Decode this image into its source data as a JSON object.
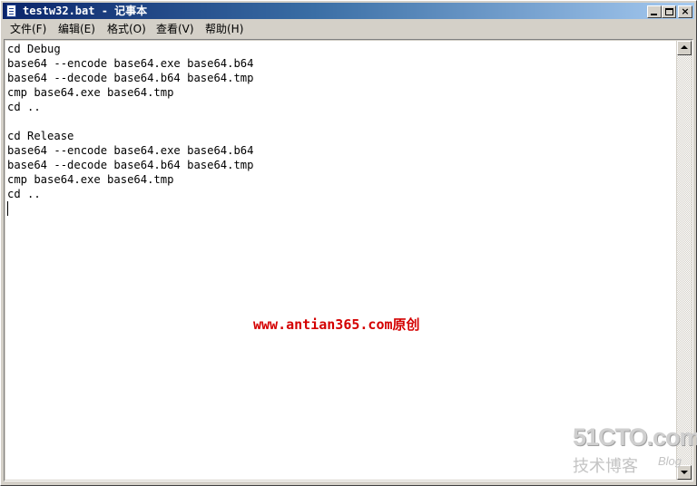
{
  "window": {
    "title": "testw32.bat - 记事本",
    "minimize_glyph": "",
    "maximize_glyph": "",
    "close_glyph": "×"
  },
  "menubar": {
    "items": [
      {
        "label": "文件(F)"
      },
      {
        "label": "编辑(E)"
      },
      {
        "label": "格式(O)"
      },
      {
        "label": "查看(V)"
      },
      {
        "label": "帮助(H)"
      }
    ]
  },
  "editor": {
    "content": "cd Debug\nbase64 --encode base64.exe base64.b64\nbase64 --decode base64.b64 base64.tmp\ncmp base64.exe base64.tmp\ncd ..\n\ncd Release\nbase64 --encode base64.exe base64.b64\nbase64 --decode base64.b64 base64.tmp\ncmp base64.exe base64.tmp\ncd ..\n"
  },
  "overlay": {
    "watermark": "www.antian365.com原创"
  },
  "logo": {
    "main": "51CTO.com",
    "sub": "技术博客",
    "blog": "Blog"
  },
  "colors": {
    "title_gradient_start": "#0a246a",
    "title_gradient_end": "#a6caf0",
    "chrome": "#d4d0c8",
    "watermark": "#d40000"
  }
}
